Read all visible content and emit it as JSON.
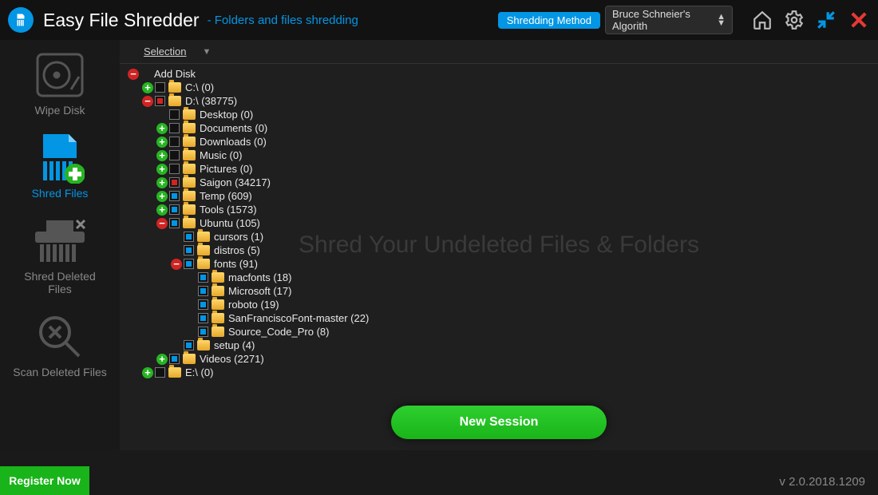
{
  "header": {
    "app_title": "Easy File Shredder",
    "subtitle": "- Folders and files shredding",
    "method_button": "Shredding Method",
    "method_value": "Bruce Schneier's Algorith"
  },
  "sidebar": {
    "items": [
      {
        "label": "Wipe Disk",
        "icon": "disk",
        "active": false
      },
      {
        "label": "Shred Files",
        "icon": "shred-file",
        "active": true
      },
      {
        "label": "Shred Deleted Files",
        "icon": "shred-deleted",
        "active": false
      },
      {
        "label": "Scan Deleted Files",
        "icon": "scan",
        "active": false
      }
    ]
  },
  "tree": {
    "selection_label": "Selection",
    "root_label": "Add Disk",
    "nodes": [
      {
        "depth": 0,
        "exp": "minus",
        "chk": "none",
        "folder": false,
        "label": "Add Disk"
      },
      {
        "depth": 1,
        "exp": "plus",
        "chk": "empty",
        "folder": true,
        "label": "C:\\ (0)"
      },
      {
        "depth": 1,
        "exp": "minus",
        "chk": "partial-red",
        "folder": true,
        "label": "D:\\ (38775)"
      },
      {
        "depth": 2,
        "exp": "none",
        "chk": "empty",
        "folder": true,
        "label": "Desktop (0)"
      },
      {
        "depth": 2,
        "exp": "plus",
        "chk": "empty",
        "folder": true,
        "label": "Documents (0)"
      },
      {
        "depth": 2,
        "exp": "plus",
        "chk": "empty",
        "folder": true,
        "label": "Downloads (0)"
      },
      {
        "depth": 2,
        "exp": "plus",
        "chk": "empty",
        "folder": true,
        "label": "Music (0)"
      },
      {
        "depth": 2,
        "exp": "plus",
        "chk": "empty",
        "folder": true,
        "label": "Pictures (0)"
      },
      {
        "depth": 2,
        "exp": "plus",
        "chk": "partial-red",
        "folder": true,
        "label": "Saigon (34217)"
      },
      {
        "depth": 2,
        "exp": "plus",
        "chk": "partial",
        "folder": true,
        "label": "Temp (609)"
      },
      {
        "depth": 2,
        "exp": "plus",
        "chk": "partial",
        "folder": true,
        "label": "Tools (1573)"
      },
      {
        "depth": 2,
        "exp": "minus",
        "chk": "partial",
        "folder": true,
        "label": "Ubuntu (105)"
      },
      {
        "depth": 3,
        "exp": "none",
        "chk": "partial",
        "folder": true,
        "label": "cursors (1)"
      },
      {
        "depth": 3,
        "exp": "none",
        "chk": "partial",
        "folder": true,
        "label": "distros (5)"
      },
      {
        "depth": 3,
        "exp": "minus",
        "chk": "partial",
        "folder": true,
        "label": "fonts (91)"
      },
      {
        "depth": 4,
        "exp": "none",
        "chk": "partial",
        "folder": true,
        "label": "macfonts (18)"
      },
      {
        "depth": 4,
        "exp": "none",
        "chk": "partial",
        "folder": true,
        "label": "Microsoft (17)"
      },
      {
        "depth": 4,
        "exp": "none",
        "chk": "partial",
        "folder": true,
        "label": "roboto (19)"
      },
      {
        "depth": 4,
        "exp": "none",
        "chk": "partial",
        "folder": true,
        "label": "SanFranciscoFont-master (22)"
      },
      {
        "depth": 4,
        "exp": "none",
        "chk": "partial",
        "folder": true,
        "label": "Source_Code_Pro (8)"
      },
      {
        "depth": 3,
        "exp": "none",
        "chk": "partial",
        "folder": true,
        "label": "setup (4)"
      },
      {
        "depth": 2,
        "exp": "plus",
        "chk": "partial",
        "folder": true,
        "label": "Videos (2271)"
      },
      {
        "depth": 1,
        "exp": "plus",
        "chk": "empty",
        "folder": true,
        "label": "E:\\ (0)"
      }
    ]
  },
  "main": {
    "watermark": "Shred Your Undeleted Files & Folders",
    "new_session": "New Session"
  },
  "footer": {
    "register": "Register Now",
    "version": "v 2.0.2018.1209"
  }
}
